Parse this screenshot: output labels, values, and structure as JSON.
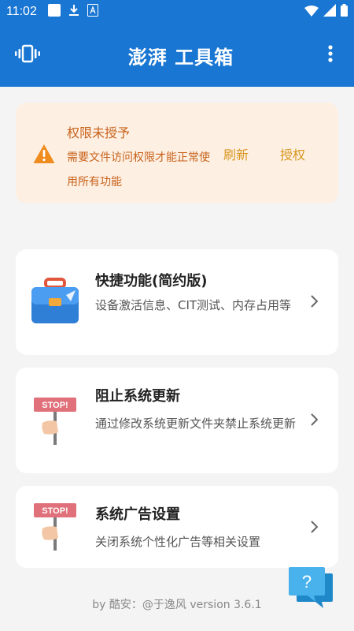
{
  "status_bar": {
    "time": "11:02",
    "icons": [
      "app-square-icon",
      "download-icon",
      "sim-app-icon",
      "wifi-icon",
      "signal-icon",
      "battery-icon"
    ]
  },
  "app_bar": {
    "title": "澎湃 工具箱",
    "left_icon": "vibrate-icon",
    "right_icon": "more-vert-icon",
    "color": "#1976d2"
  },
  "permission_notice": {
    "title": "权限未授予",
    "description": "需要文件访问权限才能正常使用所有功能",
    "refresh_label": "刷新",
    "grant_label": "授权",
    "icon": "warning-icon",
    "text_color": "#c8611a",
    "button_color": "#d9951e",
    "background": "#fdf0e3"
  },
  "features": [
    {
      "title": "快捷功能(简约版)",
      "description": "设备激活信息、CIT测试、内存占用等",
      "icon": "briefcase-icon"
    },
    {
      "title": "阻止系统更新",
      "description": "通过修改系统更新文件夹禁止系统更新",
      "icon": "stop-sign-icon",
      "sign_text": "STOP!"
    },
    {
      "title": "系统广告设置",
      "description": "关闭系统个性化广告等相关设置",
      "icon": "stop-sign-icon",
      "sign_text": "STOP!"
    }
  ],
  "footer": {
    "text": "by 酷安：@于逸风 version 3.6.1"
  },
  "help_fab": {
    "label": "?",
    "icon": "help-chat-icon",
    "color": "#3aa6e0"
  }
}
